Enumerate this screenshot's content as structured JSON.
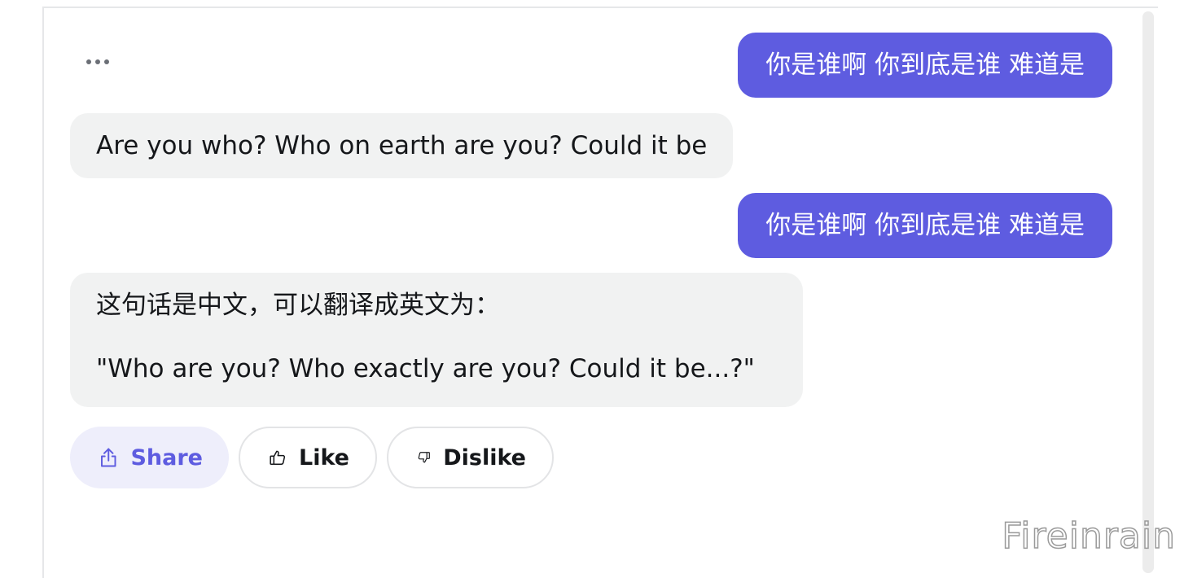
{
  "messages": [
    {
      "role": "user",
      "text": "你是谁啊 你到底是谁 难道是"
    },
    {
      "role": "assistant",
      "text": "Are you who? Who on earth are you? Could it be"
    },
    {
      "role": "user",
      "text": "你是谁啊 你到底是谁 难道是"
    },
    {
      "role": "assistant",
      "line1": "这句话是中文，可以翻译成英文为：",
      "line2": "\"Who are you? Who exactly are you? Could it be...?\""
    }
  ],
  "actions": {
    "share_label": "Share",
    "like_label": "Like",
    "dislike_label": "Dislike"
  },
  "watermark": "Fireinrain",
  "colors": {
    "accent": "#5e5ce0",
    "bot_bubble": "#f1f2f2",
    "share_bg": "#eeeefb"
  },
  "icons": [
    "more-dots-icon",
    "share-icon",
    "thumbs-up-icon",
    "thumbs-down-icon"
  ]
}
